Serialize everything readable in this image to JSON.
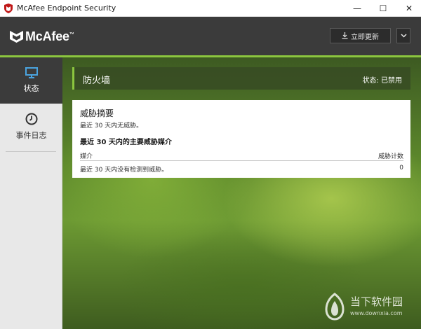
{
  "window": {
    "title": "McAfee Endpoint Security",
    "app_icon": "mcafee-shield-icon",
    "controls": {
      "minimize": "—",
      "maximize": "☐",
      "close": "✕"
    }
  },
  "header": {
    "logo_text": "McAfee",
    "trademark": "™",
    "update_button": "立即更新",
    "update_icon": "download-icon",
    "menu_icon": "chevron-down-icon",
    "accent_color": "#8cc63f"
  },
  "sidebar": {
    "items": [
      {
        "label": "状态",
        "icon": "monitor-icon",
        "active": true
      },
      {
        "label": "事件日志",
        "icon": "clock-icon",
        "active": false
      }
    ]
  },
  "main": {
    "banner": {
      "module": "防火墙",
      "status": "状态: 已禁用"
    },
    "threat_summary": {
      "title": "威胁摘要",
      "text": "最近 30 天内无威胁。",
      "section_title": "最近 30 天内的主要威胁媒介",
      "columns": [
        "媒介",
        "威胁计数"
      ],
      "rows": [
        {
          "media": "最近 30 天内没有检测到威胁。",
          "count": "0"
        }
      ]
    }
  },
  "watermark": {
    "name": "当下软件园",
    "url": "www.downxia.com"
  }
}
